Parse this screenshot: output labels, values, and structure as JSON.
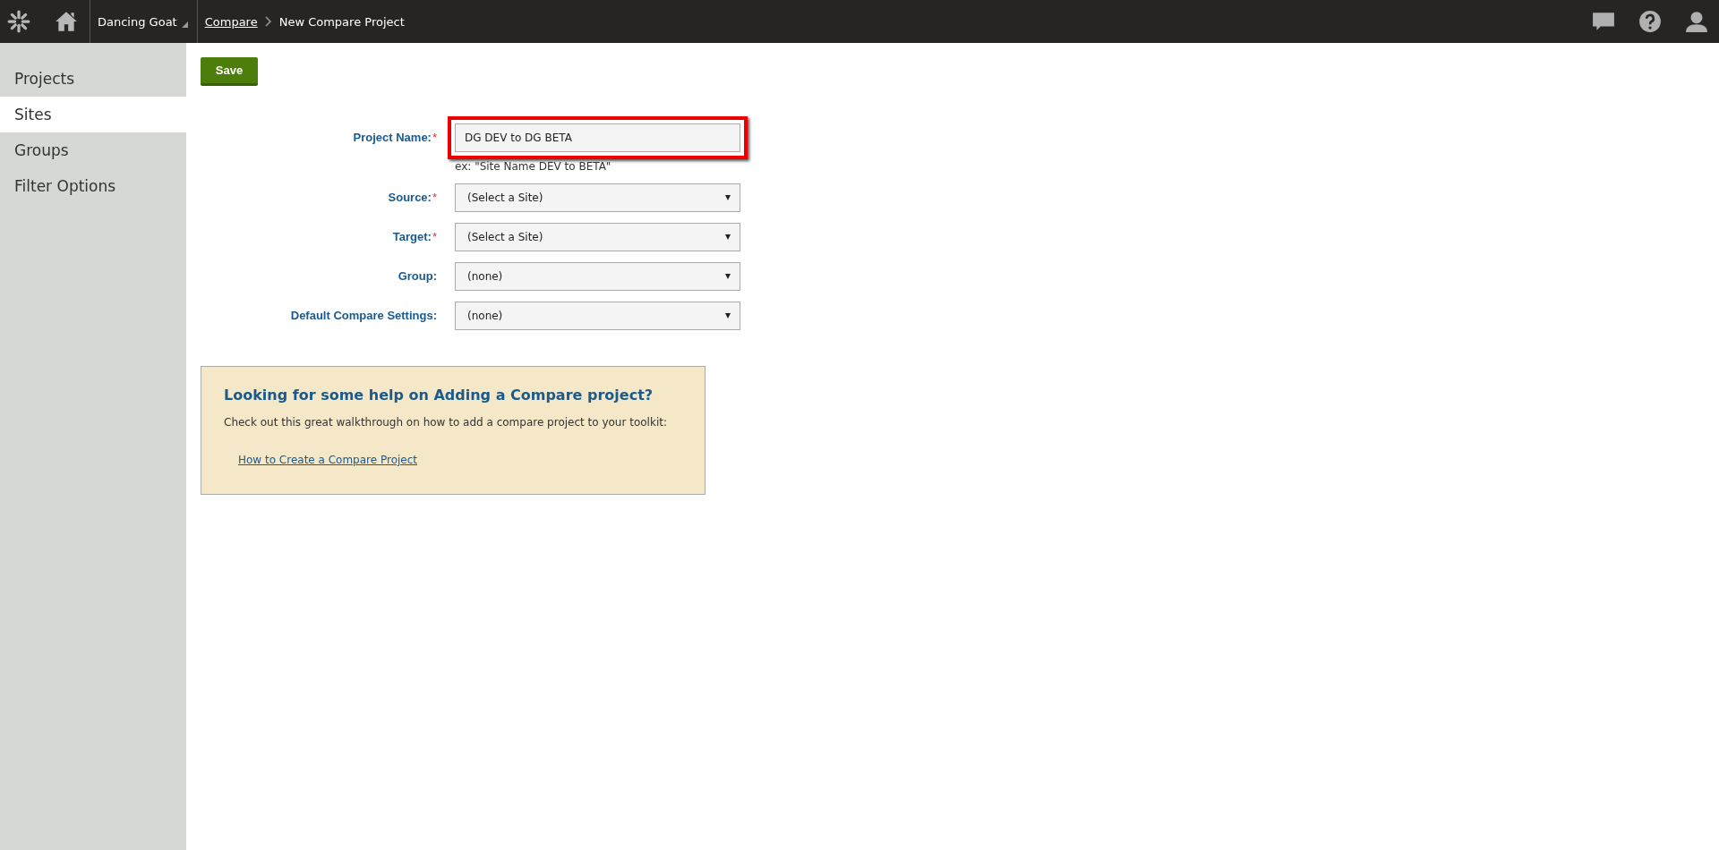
{
  "header": {
    "site": "Dancing Goat",
    "breadcrumbs": [
      {
        "label": "Compare",
        "link": true
      },
      {
        "label": "New Compare Project",
        "link": false
      }
    ]
  },
  "sidebar": {
    "items": [
      {
        "label": "Projects",
        "selected": false
      },
      {
        "label": "Sites",
        "selected": true
      },
      {
        "label": "Groups",
        "selected": false
      },
      {
        "label": "Filter Options",
        "selected": false
      }
    ]
  },
  "save_button": "Save",
  "form": {
    "required_mark": "*",
    "fields": [
      {
        "kind": "text",
        "label": "Project Name:",
        "required": true,
        "value": "DG DEV to DG BETA",
        "highlighted": true,
        "hint": "ex: \"Site Name DEV to BETA\""
      },
      {
        "kind": "select",
        "label": "Source:",
        "required": true,
        "value": "(Select a Site)",
        "highlighted": false
      },
      {
        "kind": "select",
        "label": "Target:",
        "required": true,
        "value": "(Select a Site)",
        "highlighted": false
      },
      {
        "kind": "select",
        "label": "Group:",
        "required": false,
        "value": "(none)",
        "highlighted": false
      },
      {
        "kind": "select",
        "label": "Default Compare Settings:",
        "required": false,
        "value": "(none)",
        "highlighted": false
      }
    ]
  },
  "help": {
    "title": "Looking for some help on Adding a Compare project?",
    "text": "Check out this great walkthrough on how to add a compare project to your toolkit:",
    "link": "How to Create a Compare Project"
  }
}
